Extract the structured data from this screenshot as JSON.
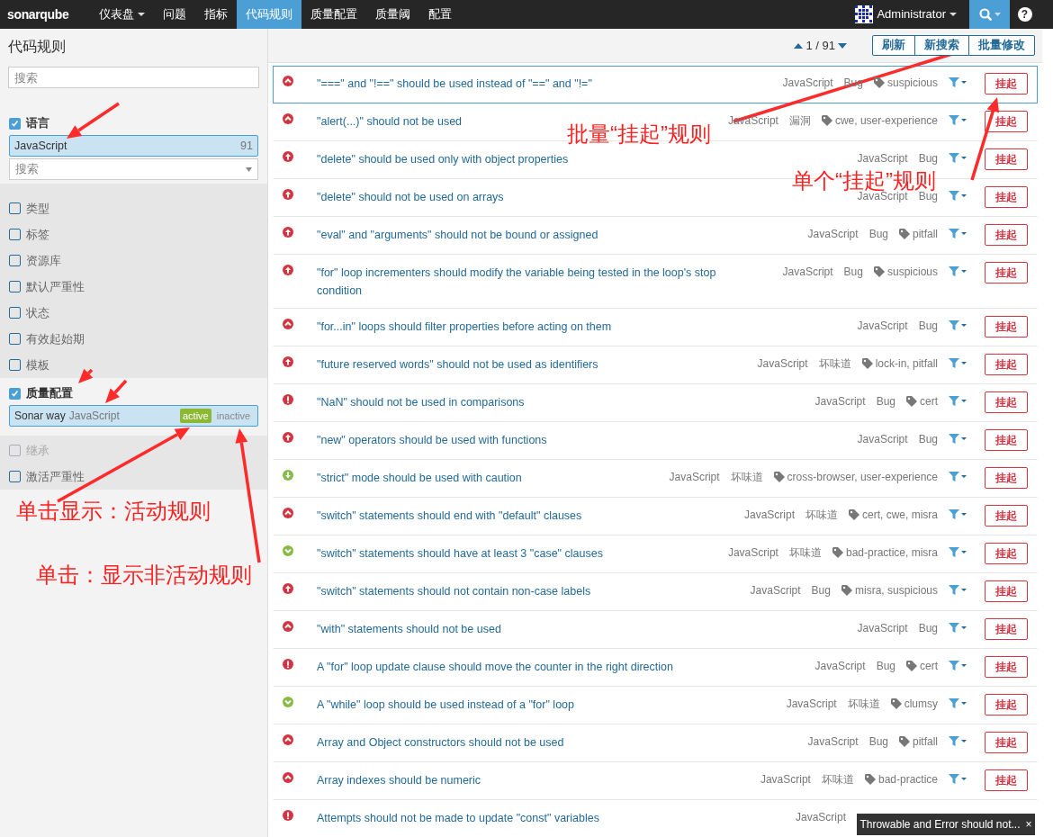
{
  "navbar": {
    "logo": "sonarqube",
    "items": [
      {
        "label": "仪表盘",
        "selected": false,
        "dropdown": true
      },
      {
        "label": "问题",
        "selected": false,
        "dropdown": false
      },
      {
        "label": "指标",
        "selected": false,
        "dropdown": false
      },
      {
        "label": "代码规则",
        "selected": true,
        "dropdown": false
      },
      {
        "label": "质量配置",
        "selected": false,
        "dropdown": false
      },
      {
        "label": "质量阈",
        "selected": false,
        "dropdown": false
      },
      {
        "label": "配置",
        "selected": false,
        "dropdown": false
      }
    ],
    "user": "Administrator",
    "help": "?"
  },
  "sidebar": {
    "title": "代码规则",
    "search": {
      "placeholder": "搜索"
    },
    "facets": [
      {
        "kind": "list",
        "label": "语言",
        "checked": true,
        "items": [
          {
            "label": "JavaScript",
            "count": "91",
            "selected": true
          }
        ],
        "search": {
          "placeholder": "搜索"
        }
      },
      {
        "kind": "plain",
        "label": "类型",
        "checked": false,
        "disabled": false
      },
      {
        "kind": "plain",
        "label": "标签",
        "checked": false,
        "disabled": false
      },
      {
        "kind": "plain",
        "label": "资源库",
        "checked": false,
        "disabled": false
      },
      {
        "kind": "plain",
        "label": "默认严重性",
        "checked": false,
        "disabled": false
      },
      {
        "kind": "plain",
        "label": "状态",
        "checked": false,
        "disabled": false
      },
      {
        "kind": "plain",
        "label": "有效起始期",
        "checked": false,
        "disabled": false
      },
      {
        "kind": "plain",
        "label": "模板",
        "checked": false,
        "disabled": false
      },
      {
        "kind": "profile",
        "label": "质量配置",
        "checked": true,
        "items": [
          {
            "name": "Sonar way",
            "language": "JavaScript",
            "active": "active",
            "inactive": "inactive",
            "active_selected": true,
            "selected": true
          }
        ]
      },
      {
        "kind": "plain",
        "label": "继承",
        "checked": false,
        "disabled": true
      },
      {
        "kind": "plain",
        "label": "激活严重性",
        "checked": false,
        "disabled": false
      }
    ]
  },
  "toolbar": {
    "pager": "1 / 91",
    "buttons": [
      "刷新",
      "新搜索",
      "批量修改"
    ]
  },
  "rules": [
    {
      "kind": "major",
      "title": "\"===\" and \"!==\" should be used instead of \"==\" and \"!=\"",
      "language": "JavaScript",
      "type": "Bug",
      "tags": "suspicious",
      "selected": true,
      "action": "挂起"
    },
    {
      "kind": "major",
      "title": "\"alert(...)\" should not be used",
      "language": "JavaScript",
      "type": "漏洞",
      "tags": "cwe, user-experience",
      "selected": false,
      "action": "挂起"
    },
    {
      "kind": "critical",
      "title": "\"delete\" should be used only with object properties",
      "language": "JavaScript",
      "type": "Bug",
      "selected": false,
      "action": "挂起"
    },
    {
      "kind": "critical",
      "title": "\"delete\" should not be used on arrays",
      "language": "JavaScript",
      "type": "Bug",
      "selected": false,
      "action": "挂起"
    },
    {
      "kind": "critical",
      "title": "\"eval\" and \"arguments\" should not be bound or assigned",
      "language": "JavaScript",
      "type": "Bug",
      "tags": "pitfall",
      "selected": false,
      "action": "挂起"
    },
    {
      "kind": "critical",
      "title": "\"for\" loop incrementers should modify the variable being tested in the loop's stop condition",
      "language": "JavaScript",
      "type": "Bug",
      "tags": "suspicious",
      "selected": false,
      "action": "挂起"
    },
    {
      "kind": "major",
      "title": "\"for...in\" loops should filter properties before acting on them",
      "language": "JavaScript",
      "type": "Bug",
      "selected": false,
      "action": "挂起"
    },
    {
      "kind": "critical",
      "title": "\"future reserved words\" should not be used as identifiers",
      "language": "JavaScript",
      "type": "坏味道",
      "tags": "lock-in, pitfall",
      "selected": false,
      "action": "挂起"
    },
    {
      "kind": "blocker",
      "title": "\"NaN\" should not be used in comparisons",
      "language": "JavaScript",
      "type": "Bug",
      "tags": "cert",
      "selected": false,
      "action": "挂起"
    },
    {
      "kind": "critical",
      "title": "\"new\" operators should be used with functions",
      "language": "JavaScript",
      "type": "Bug",
      "selected": false,
      "action": "挂起"
    },
    {
      "kind": "minor",
      "title": "\"strict\" mode should be used with caution",
      "language": "JavaScript",
      "type": "坏味道",
      "tags": "cross-browser, user-experience",
      "selected": false,
      "action": "挂起"
    },
    {
      "kind": "major",
      "title": "\"switch\" statements should end with \"default\" clauses",
      "language": "JavaScript",
      "type": "坏味道",
      "tags": "cert, cwe, misra",
      "selected": false,
      "action": "挂起"
    },
    {
      "kind": "info",
      "title": "\"switch\" statements should have at least 3 \"case\" clauses",
      "language": "JavaScript",
      "type": "坏味道",
      "tags": "bad-practice, misra",
      "selected": false,
      "action": "挂起"
    },
    {
      "kind": "critical",
      "title": "\"switch\" statements should not contain non-case labels",
      "language": "JavaScript",
      "type": "Bug",
      "tags": "misra, suspicious",
      "selected": false,
      "action": "挂起"
    },
    {
      "kind": "major",
      "title": "\"with\" statements should not be used",
      "language": "JavaScript",
      "type": "Bug",
      "selected": false,
      "action": "挂起"
    },
    {
      "kind": "blocker",
      "title": "A \"for\" loop update clause should move the counter in the right direction",
      "language": "JavaScript",
      "type": "Bug",
      "tags": "cert",
      "selected": false,
      "action": "挂起"
    },
    {
      "kind": "info",
      "title": "A \"while\" loop should be used instead of a \"for\" loop",
      "language": "JavaScript",
      "type": "坏味道",
      "tags": "clumsy",
      "selected": false,
      "action": "挂起"
    },
    {
      "kind": "major",
      "title": "Array and Object constructors should not be used",
      "language": "JavaScript",
      "type": "Bug",
      "tags": "pitfall",
      "selected": false,
      "action": "挂起"
    },
    {
      "kind": "major",
      "title": "Array indexes should be numeric",
      "language": "JavaScript",
      "type": "坏味道",
      "tags": "bad-practice",
      "selected": false,
      "action": "挂起"
    },
    {
      "kind": "blocker",
      "title": "Attempts should not be made to update \"const\" variables",
      "language": "JavaScript",
      "selected": false
    }
  ],
  "toast": {
    "text": "Throwable and Error should not...",
    "close": "×"
  },
  "annotations": [
    "批量“挂起”规则",
    "单个“挂起”规则",
    "单击显示：活动规则",
    "单击：显示非活动规则"
  ]
}
